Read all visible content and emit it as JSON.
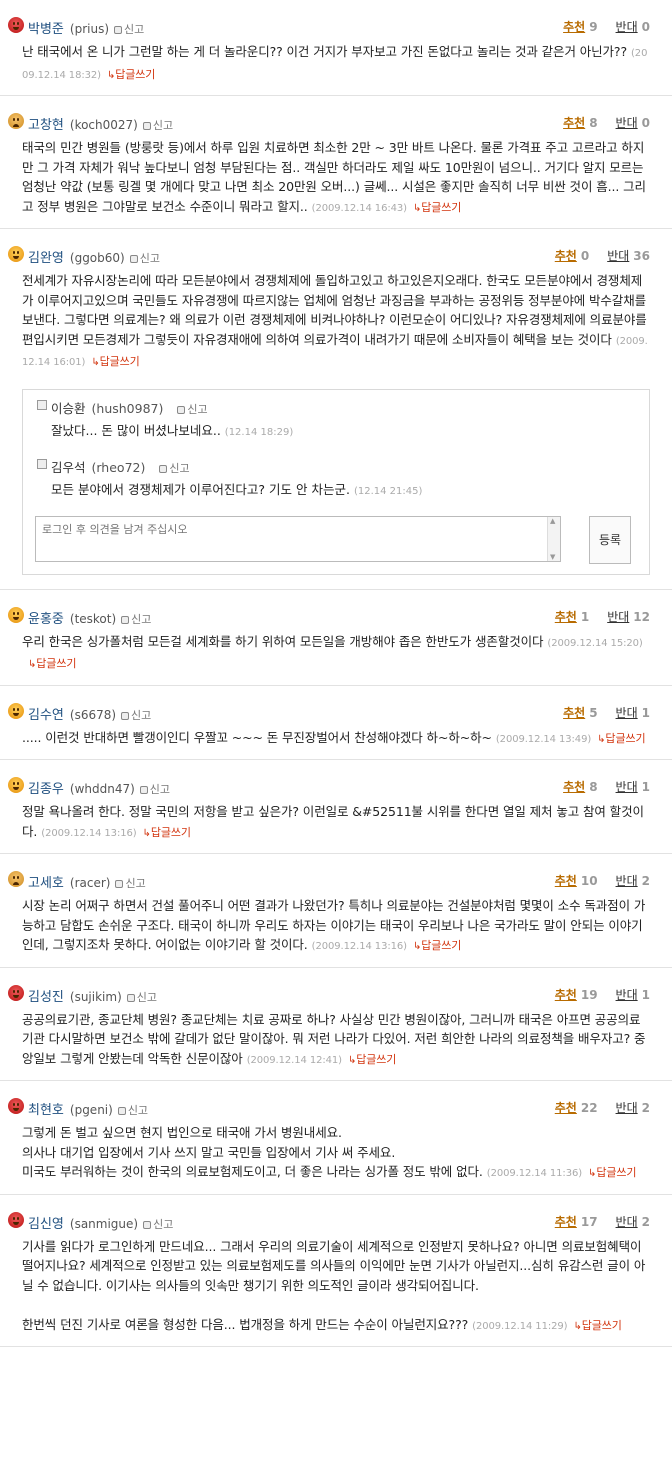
{
  "labels": {
    "report": "신고",
    "recommend": "추천",
    "oppose": "반대",
    "reply_link": "답글쓰기",
    "reply_arrow": "↳"
  },
  "comments": [
    {
      "name": "박병준",
      "id": "(prius)",
      "face": "red",
      "rec": "9",
      "opp": "0",
      "text": "난 태국에서 온 니가 그런말 하는 게 더 놀라운디?? 이건 거지가 부자보고 가진 돈없다고 놀리는 것과 같은거 아닌가??",
      "date": "(2009.12.14 18:32)"
    },
    {
      "name": "고창현",
      "id": "(koch0027)",
      "face": "tan",
      "rec": "8",
      "opp": "0",
      "text": "태국의 민간 병원들 (방룽랏 등)에서 하루 입원 치료하면 최소한 2만 ~ 3만 바트 나온다. 물론 가격표 주고 고르라고 하지만 그 가격 자체가 워낙 높다보니 엄청 부담된다는 점.. 객실만 하더라도 제일 싸도 10만원이 넘으니.. 거기다 알지 모르는 엄청난 약값 (보통 링겔 몇 개에다 맞고 나면 최소 20만원 오버...) 글쎄... 시설은 좋지만 솔직히 너무 비싼 것이 흠... 그리고 정부 병원은 그야말로 보건소 수준이니 뭐라고 할지..",
      "date": "(2009.12.14 16:43)"
    },
    {
      "name": "김완영",
      "id": "(ggob60)",
      "face": "orange",
      "rec": "0",
      "opp": "36",
      "text": "전세계가 자유시장논리에 따라 모든분야에서 경쟁체제에 돌입하고있고 하고있은지오래다. 한국도 모든분야에서 경쟁체제가 이루어지고있으며 국민들도 자유경쟁에 따르지않는 업체에 엄청난 과징금을 부과하는 공정위등 정부분야에 박수갈채를 보낸다. 그렇다면 의료계는? 왜 의료가 이런 경쟁체제에 비켜나야하나? 이런모순이 어디있나? 자유경쟁체제에 의료분야를 편입시키면 모든경제가 그렇듯이 자유경재애에 의하여 의료가격이 내려가기 때문에 소비자들이 혜택을 보는 것이다",
      "date": "(2009.12.14 16:01)"
    },
    {
      "name": "윤홍중",
      "id": "(teskot)",
      "face": "orange",
      "rec": "1",
      "opp": "12",
      "text": "우리 한국은 싱가폴처럼 모든걸 세계화를 하기 위하여 모든일을 개방해야 좁은 한반도가 생존할것이다",
      "date": "(2009.12.14 15:20)"
    },
    {
      "name": "김수연",
      "id": "(s6678)",
      "face": "orange",
      "rec": "5",
      "opp": "1",
      "text": "..... 이런것 반대하면 빨갱이인디 우짤꼬 ~~~ 돈 무진장벌어서 찬성해야겠다 하~하~하~",
      "date": "(2009.12.14 13:49)"
    },
    {
      "name": "김종우",
      "id": "(whddn47)",
      "face": "orange",
      "rec": "8",
      "opp": "1",
      "text": "정말 욕나올려 한다. 정말 국민의 저항을 받고 싶은가? 이런일로 &#52511불 시위를 한다면 열일 제처 놓고 참여 할것이다.",
      "date": "(2009.12.14 13:16)"
    },
    {
      "name": "고세호",
      "id": "(racer)",
      "face": "tan",
      "rec": "10",
      "opp": "2",
      "text": "시장 논리 어쩌구 하면서 건설 풀어주니 어떤 결과가 나왔던가? 특히나 의료분야는 건설분야처럼 몇몇이 소수 독과점이 가능하고 담합도 손쉬운 구조다. 태국이 하니까 우리도 하자는 이야기는 태국이 우리보나 나은 국가라도 말이 안되는 이야기인데, 그렇지조차 못하다. 어이없는 이야기라 할 것이다.",
      "date": "(2009.12.14 13:16)"
    },
    {
      "name": "김성진",
      "id": "(sujikim)",
      "face": "red",
      "rec": "19",
      "opp": "1",
      "text": "공공의료기관, 종교단체 병원? 종교단체는 치료 공짜로 하나? 사실상 민간 병원이잖아, 그러니까 태국은 아프면 공공의료기관 다시말하면 보건소 밖에 갈데가 없단 말이잖아. 뭐 저런 나라가 다있어. 저런 희안한 나라의 의료정책을 배우자고? 중앙일보 그렇게 안봤는데 악독한 신문이잖아",
      "date": "(2009.12.14 12:41)"
    },
    {
      "name": "최현호",
      "id": "(pgeni)",
      "face": "red",
      "rec": "22",
      "opp": "2",
      "lines": [
        "그렇게 돈 벌고 싶으면 현지 법인으로 태국애 가서 병원내세요.",
        "의사나 대기업 입장에서 기사 쓰지 말고 국민들 입장에서 기사 써 주세요.",
        "미국도 부러워하는 것이 한국의 의료보험제도이고, 더 좋은 나라는 싱가폴 정도 밖에 없다."
      ],
      "date": "(2009.12.14 11:36)"
    },
    {
      "name": "김신영",
      "id": "(sanmigue)",
      "face": "red",
      "rec": "17",
      "opp": "2",
      "lines": [
        "기사를 읽다가 로그인하게 만드네요... 그래서 우리의 의료기술이 세계적으로 인정받지 못하나요? 아니면 의료보험혜택이 떨어지나요? 세계적으로 인정받고 있는 의료보험제도를 의사들의 이익에만 눈면 기사가 아닐런지...심히 유감스런 글이 아닐 수 없습니다. 이기사는 의사들의 잇속만 챙기기 위한 의도적인 글이라 생각되어집니다.",
        "",
        "한번씩 던진 기사로 여론을 형성한 다음... 법개정을 하게 만드는 수순이 아닐런지요???"
      ],
      "date": "(2009.12.14 11:29)"
    }
  ],
  "replies": [
    {
      "name": "이승환",
      "id": "(hush0987)",
      "text": "잘났다... 돈 많이 버셨나보네요..",
      "date": "(12.14 18:29)"
    },
    {
      "name": "김우석",
      "id": "(rheo72)",
      "text": "모든 분야에서 경쟁체제가 이루어진다고? 기도 안 차는군.",
      "date": "(12.14 21:45)"
    }
  ],
  "editor": {
    "placeholder": "로그인 후 의견을 남겨 주십시오",
    "submit": "등록"
  }
}
